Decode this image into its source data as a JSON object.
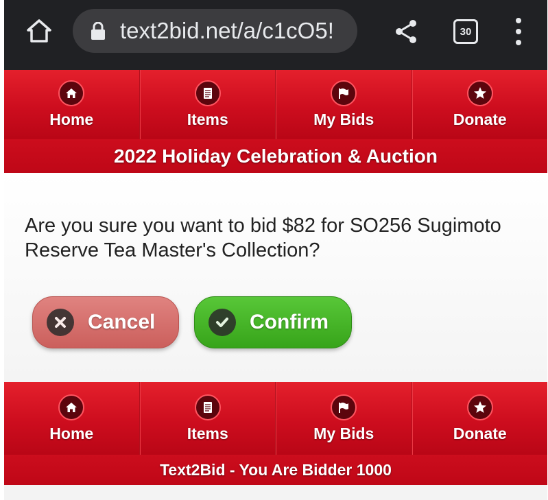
{
  "browser": {
    "url": "text2bid.net/a/c1cO5!",
    "tab_count": "30",
    "icons": [
      "home-icon",
      "lock-icon",
      "share-icon",
      "tabs-icon",
      "more-vert-icon"
    ]
  },
  "nav_top": {
    "items": [
      {
        "label": "Home",
        "icon": "home-icon"
      },
      {
        "label": "Items",
        "icon": "document-icon"
      },
      {
        "label": "My Bids",
        "icon": "flag-icon"
      },
      {
        "label": "Donate",
        "icon": "star-icon"
      }
    ]
  },
  "event_title": "2022 Holiday Celebration & Auction",
  "confirm_dialog": {
    "question": "Are you sure you want to bid $82 for SO256 Sugimoto Reserve Tea Master's Collection?",
    "cancel_label": "Cancel",
    "confirm_label": "Confirm"
  },
  "nav_bottom": {
    "items": [
      {
        "label": "Home",
        "icon": "home-icon"
      },
      {
        "label": "Items",
        "icon": "document-icon"
      },
      {
        "label": "My Bids",
        "icon": "flag-icon"
      },
      {
        "label": "Donate",
        "icon": "star-icon"
      }
    ]
  },
  "footer_text": "Text2Bid - You Are Bidder 1000",
  "colors": {
    "nav_red": "#cd0d1e",
    "cancel": "#d46d6a",
    "confirm": "#45b328",
    "browser_bg": "#202124"
  }
}
